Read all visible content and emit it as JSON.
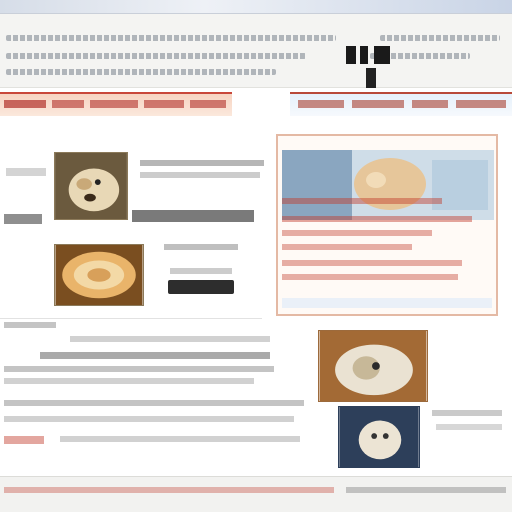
{
  "colors": {
    "accent": "#c0392b",
    "nav_left_bg": "#f7d4c2",
    "nav_right_bg": "#e6f1fb",
    "border": "#e4b9a4"
  },
  "icons": [
    "logo-icon"
  ]
}
